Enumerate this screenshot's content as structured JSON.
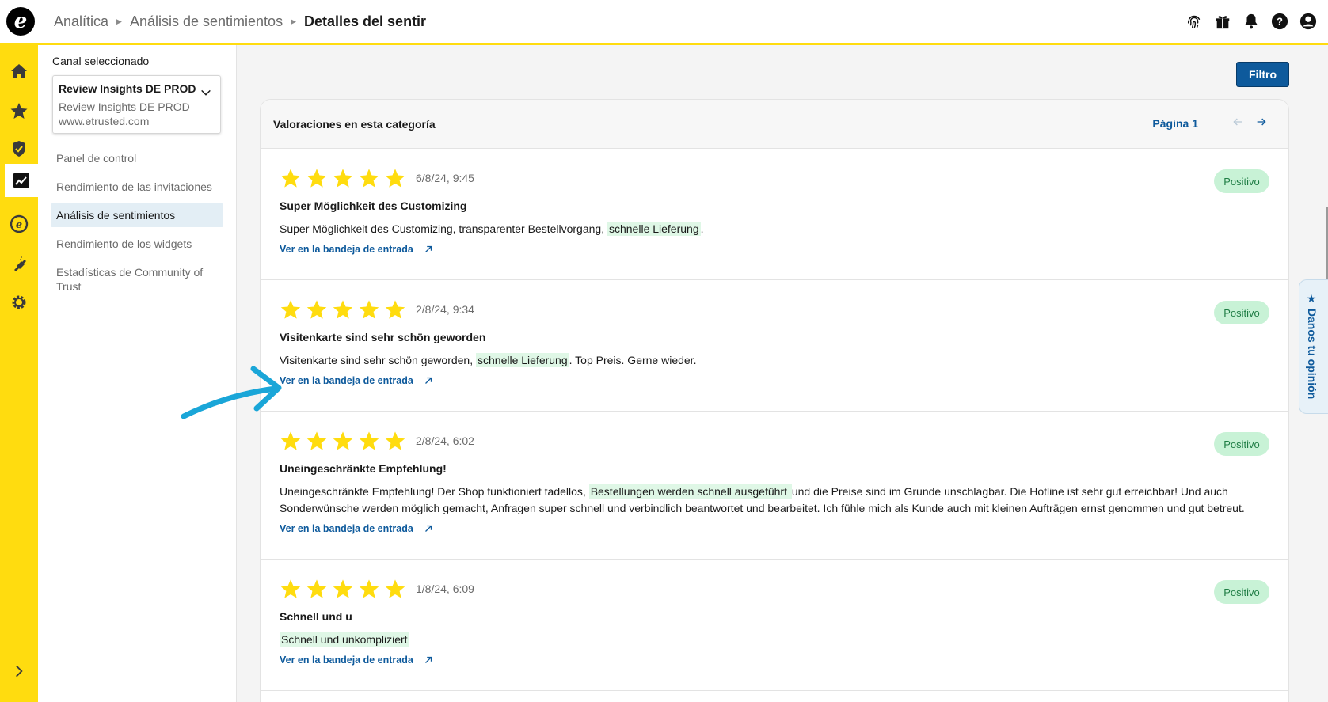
{
  "header": {
    "breadcrumbs": [
      "Analítica",
      "Análisis de sentimientos"
    ],
    "current": "Detalles del sentir"
  },
  "top_icons": [
    "fingerprint-icon",
    "gift-icon",
    "bell-icon",
    "help-icon",
    "user-icon"
  ],
  "rail_icons": [
    "home-icon",
    "star-icon",
    "shield-check-icon",
    "analytics-icon",
    "etrusted-icon",
    "plug-icon",
    "gear-icon",
    "chevron-right-icon"
  ],
  "sidebar": {
    "channel_label": "Canal seleccionado",
    "channel_title": "Review Insights DE PROD",
    "channel_name": "Review Insights DE PROD",
    "channel_url": "www.etrusted.com",
    "items": [
      {
        "label": "Panel de control"
      },
      {
        "label": "Rendimiento de las invitaciones"
      },
      {
        "label": "Análisis de sentimientos"
      },
      {
        "label": "Rendimiento de los widgets"
      },
      {
        "label": "Estadísticas de Community of Trust"
      }
    ],
    "active_index": 2
  },
  "main": {
    "filter_label": "Filtro",
    "card_title": "Valoraciones en esta categoría",
    "page_label": "Página 1"
  },
  "reviews": [
    {
      "rating": 5,
      "date": "6/8/24, 9:45",
      "title": "Super Möglichkeit des Customizing",
      "text_before": "Super Möglichkeit des Customizing, transparenter Bestellvorgang, ",
      "highlight": "schnelle Lieferung",
      "text_after": ".",
      "badge": "Positivo",
      "link": "Ver en la bandeja de entrada"
    },
    {
      "rating": 5,
      "date": "2/8/24, 9:34",
      "title": "Visitenkarte sind sehr schön geworden",
      "text_before": "Visitenkarte sind sehr schön geworden, ",
      "highlight": "schnelle Lieferung",
      "text_after": ". Top Preis. Gerne wieder.",
      "badge": "Positivo",
      "link": "Ver en la bandeja de entrada"
    },
    {
      "rating": 5,
      "date": "2/8/24, 6:02",
      "title": "Uneingeschränkte Empfehlung!",
      "text_before": "Uneingeschränkte Empfehlung! Der Shop funktioniert tadellos, ",
      "highlight": "Bestellungen werden schnell ausgeführt ",
      "text_after": " und die Preise sind im Grunde unschlagbar. Die Hotline ist sehr gut erreichbar! Und auch Sonderwünsche werden möglich gemacht, Anfragen super schnell und verbindlich beantwortet und bearbeitet. Ich fühle mich als Kunde auch mit kleinen Aufträgen ernst genommen und gut betreut.",
      "badge": "Positivo",
      "link": "Ver en la bandeja de entrada"
    },
    {
      "rating": 5,
      "date": "1/8/24, 6:09",
      "title": "Schnell und u",
      "text_before": "",
      "highlight": "Schnell und unkompliziert",
      "text_after": "",
      "badge": "Positivo",
      "link": "Ver en la bandeja de entrada"
    }
  ],
  "feedback_tab": "★ Danos tu opinión",
  "colors": {
    "brand_yellow": "#ffdc0f",
    "link_blue": "#0e5a9c",
    "star": "#ffdc0f",
    "positive_badge": "#c8f2d6",
    "annotation_arrow": "#1aa6d8"
  }
}
